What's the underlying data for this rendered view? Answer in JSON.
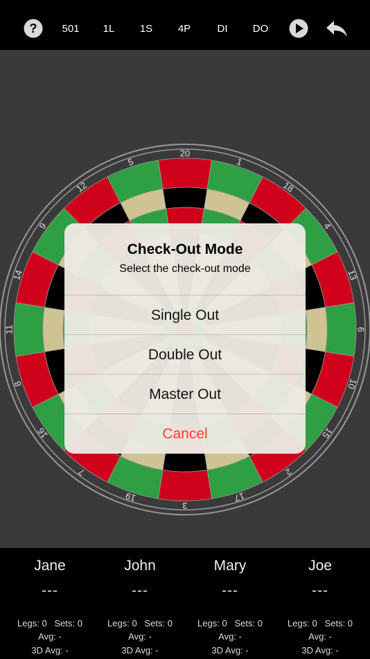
{
  "toolbar": {
    "help_icon": "question-circle-icon",
    "items": [
      "501",
      "1L",
      "1S",
      "4P",
      "DI",
      "DO"
    ],
    "play_icon": "play-circle-icon",
    "undo_icon": "undo-arrow-icon"
  },
  "board": {
    "numbers": [
      "20",
      "1",
      "18",
      "4",
      "13",
      "6",
      "10",
      "15",
      "2",
      "17",
      "3",
      "19",
      "7",
      "16",
      "8",
      "11",
      "14",
      "9",
      "12",
      "5"
    ],
    "colors": {
      "red": "#d0021b",
      "green": "#2ea043",
      "black": "#000000",
      "cream": "#cfc394",
      "wire": "#9a9a9a"
    }
  },
  "dialog": {
    "title": "Check-Out Mode",
    "message": "Select the check-out mode",
    "options": [
      "Single Out",
      "Double Out",
      "Master Out"
    ],
    "cancel": "Cancel",
    "cancel_color": "#ff3b30"
  },
  "players": [
    {
      "name": "Jane",
      "score": "---",
      "legs_label": "Legs:",
      "legs": "0",
      "sets_label": "Sets:",
      "sets": "0",
      "avg": "Avg: -",
      "avg3d": "3D Avg: -"
    },
    {
      "name": "John",
      "score": "---",
      "legs_label": "Legs:",
      "legs": "0",
      "sets_label": "Sets:",
      "sets": "0",
      "avg": "Avg: -",
      "avg3d": "3D Avg: -"
    },
    {
      "name": "Mary",
      "score": "---",
      "legs_label": "Legs:",
      "legs": "0",
      "sets_label": "Sets:",
      "sets": "0",
      "avg": "Avg: -",
      "avg3d": "3D Avg: -"
    },
    {
      "name": "Joe",
      "score": "---",
      "legs_label": "Legs:",
      "legs": "0",
      "sets_label": "Sets:",
      "sets": "0",
      "avg": "Avg: -",
      "avg3d": "3D Avg: -"
    }
  ]
}
